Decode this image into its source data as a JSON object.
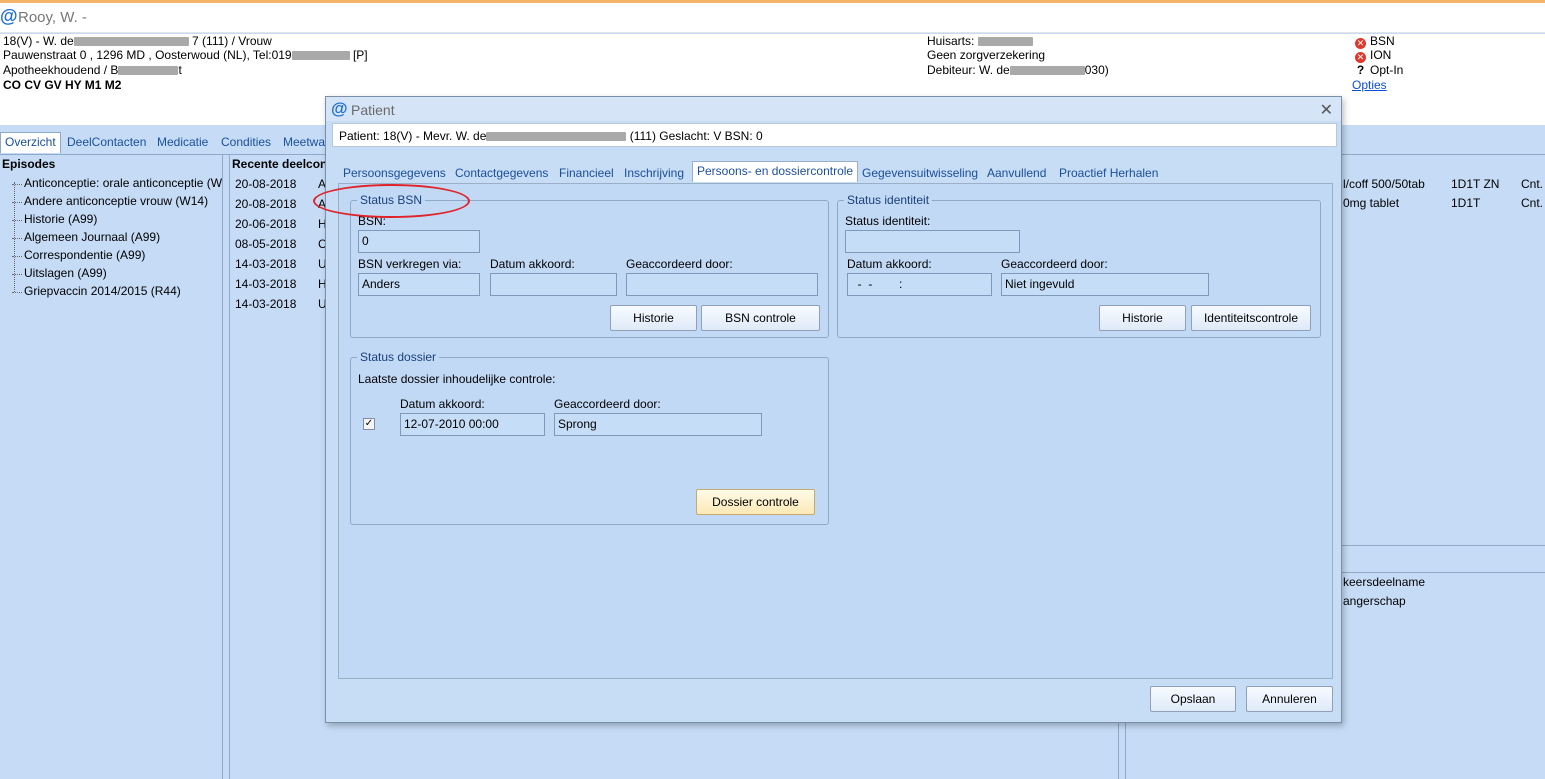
{
  "window": {
    "title": "Rooy, W. -"
  },
  "header": {
    "line1_prefix": "18(V) - W. de",
    "line1_suffix": "7 (111) / Vrouw",
    "line2_prefix": "Pauwenstraat 0 , 1296 MD , Oosterwoud (NL), Tel:019",
    "line2_suffix": "[P]",
    "line3_prefix": "Apotheekhoudend / B",
    "line3_suffix": "t",
    "line4": "CO CV GV HY M1 M2",
    "huisarts_label": "Huisarts:",
    "zorgverzekering": "Geen zorgverzekering",
    "debiteur_prefix": "Debiteur: W. de",
    "debiteur_suffix": "030)",
    "status": [
      {
        "icon": "error-icon",
        "label": "BSN"
      },
      {
        "icon": "error-icon",
        "label": "ION"
      },
      {
        "icon": "question-icon",
        "label": "Opt-In"
      }
    ],
    "opties_link": "Opties"
  },
  "bg_tabs": [
    "Overzicht",
    "DeelContacten",
    "Medicatie",
    "Condities",
    "Meetwa"
  ],
  "episodes": {
    "title": "Episodes",
    "items": [
      "Anticonceptie: orale anticonceptie (W",
      "Andere anticonceptie vrouw (W14)",
      "Historie (A99)",
      "Algemeen Journaal (A99)",
      "Correspondentie (A99)",
      "Uitslagen (A99)",
      "Griepvaccin 2014/2015 (R44)"
    ]
  },
  "recent": {
    "title": "Recente deelcont",
    "rows": [
      {
        "date": "20-08-2018",
        "letter": "A"
      },
      {
        "date": "20-08-2018",
        "letter": "A"
      },
      {
        "date": "20-06-2018",
        "letter": "H"
      },
      {
        "date": "08-05-2018",
        "letter": "C"
      },
      {
        "date": "14-03-2018",
        "letter": "U"
      },
      {
        "date": "14-03-2018",
        "letter": "H"
      },
      {
        "date": "14-03-2018",
        "letter": "U"
      }
    ]
  },
  "medication": [
    {
      "name": "l/coff 500/50tab",
      "dose": "1D1T ZN",
      "extra": "Cnt."
    },
    {
      "name": "0mg tablet",
      "dose": "1D1T",
      "extra": "Cnt."
    }
  ],
  "right_lower": [
    "keersdeelname",
    "angerschap"
  ],
  "dialog": {
    "title": "Patient",
    "patient_prefix": "Patient: 18(V) - Mevr. W. de",
    "patient_suffix": "(111) Geslacht: V BSN: 0",
    "tabs": [
      "Persoonsgegevens",
      "Contactgegevens",
      "Financieel",
      "Inschrijving",
      "Persoons- en dossiercontrole",
      "Gegevensuitwisseling",
      "Aanvullend",
      "Proactief Herhalen"
    ],
    "status_bsn": {
      "legend": "Status BSN",
      "bsn_label": "BSN:",
      "bsn_value": "0",
      "verkregen_label": "BSN verkregen via:",
      "verkregen_value": "Anders",
      "datum_label": "Datum akkoord:",
      "datum_value": "",
      "door_label": "Geaccordeerd door:",
      "door_value": "",
      "historie_button": "Historie",
      "controle_button": "BSN controle"
    },
    "status_identiteit": {
      "legend": "Status identiteit",
      "status_label": "Status identiteit:",
      "status_value": "",
      "datum_label": "Datum akkoord:",
      "datum_value": "  -  -        :",
      "door_label": "Geaccordeerd door:",
      "door_value": "Niet ingevuld",
      "historie_button": "Historie",
      "controle_button": "Identiteitscontrole"
    },
    "status_dossier": {
      "legend": "Status dossier",
      "laatste_label": "Laatste dossier inhoudelijke controle:",
      "checked": true,
      "datum_label": "Datum akkoord:",
      "datum_value": "12-07-2010 00:00",
      "door_label": "Geaccordeerd door:",
      "door_value": "Sprong",
      "controle_button": "Dossier controle"
    },
    "opslaan_button": "Opslaan",
    "annuleren_button": "Annuleren"
  }
}
